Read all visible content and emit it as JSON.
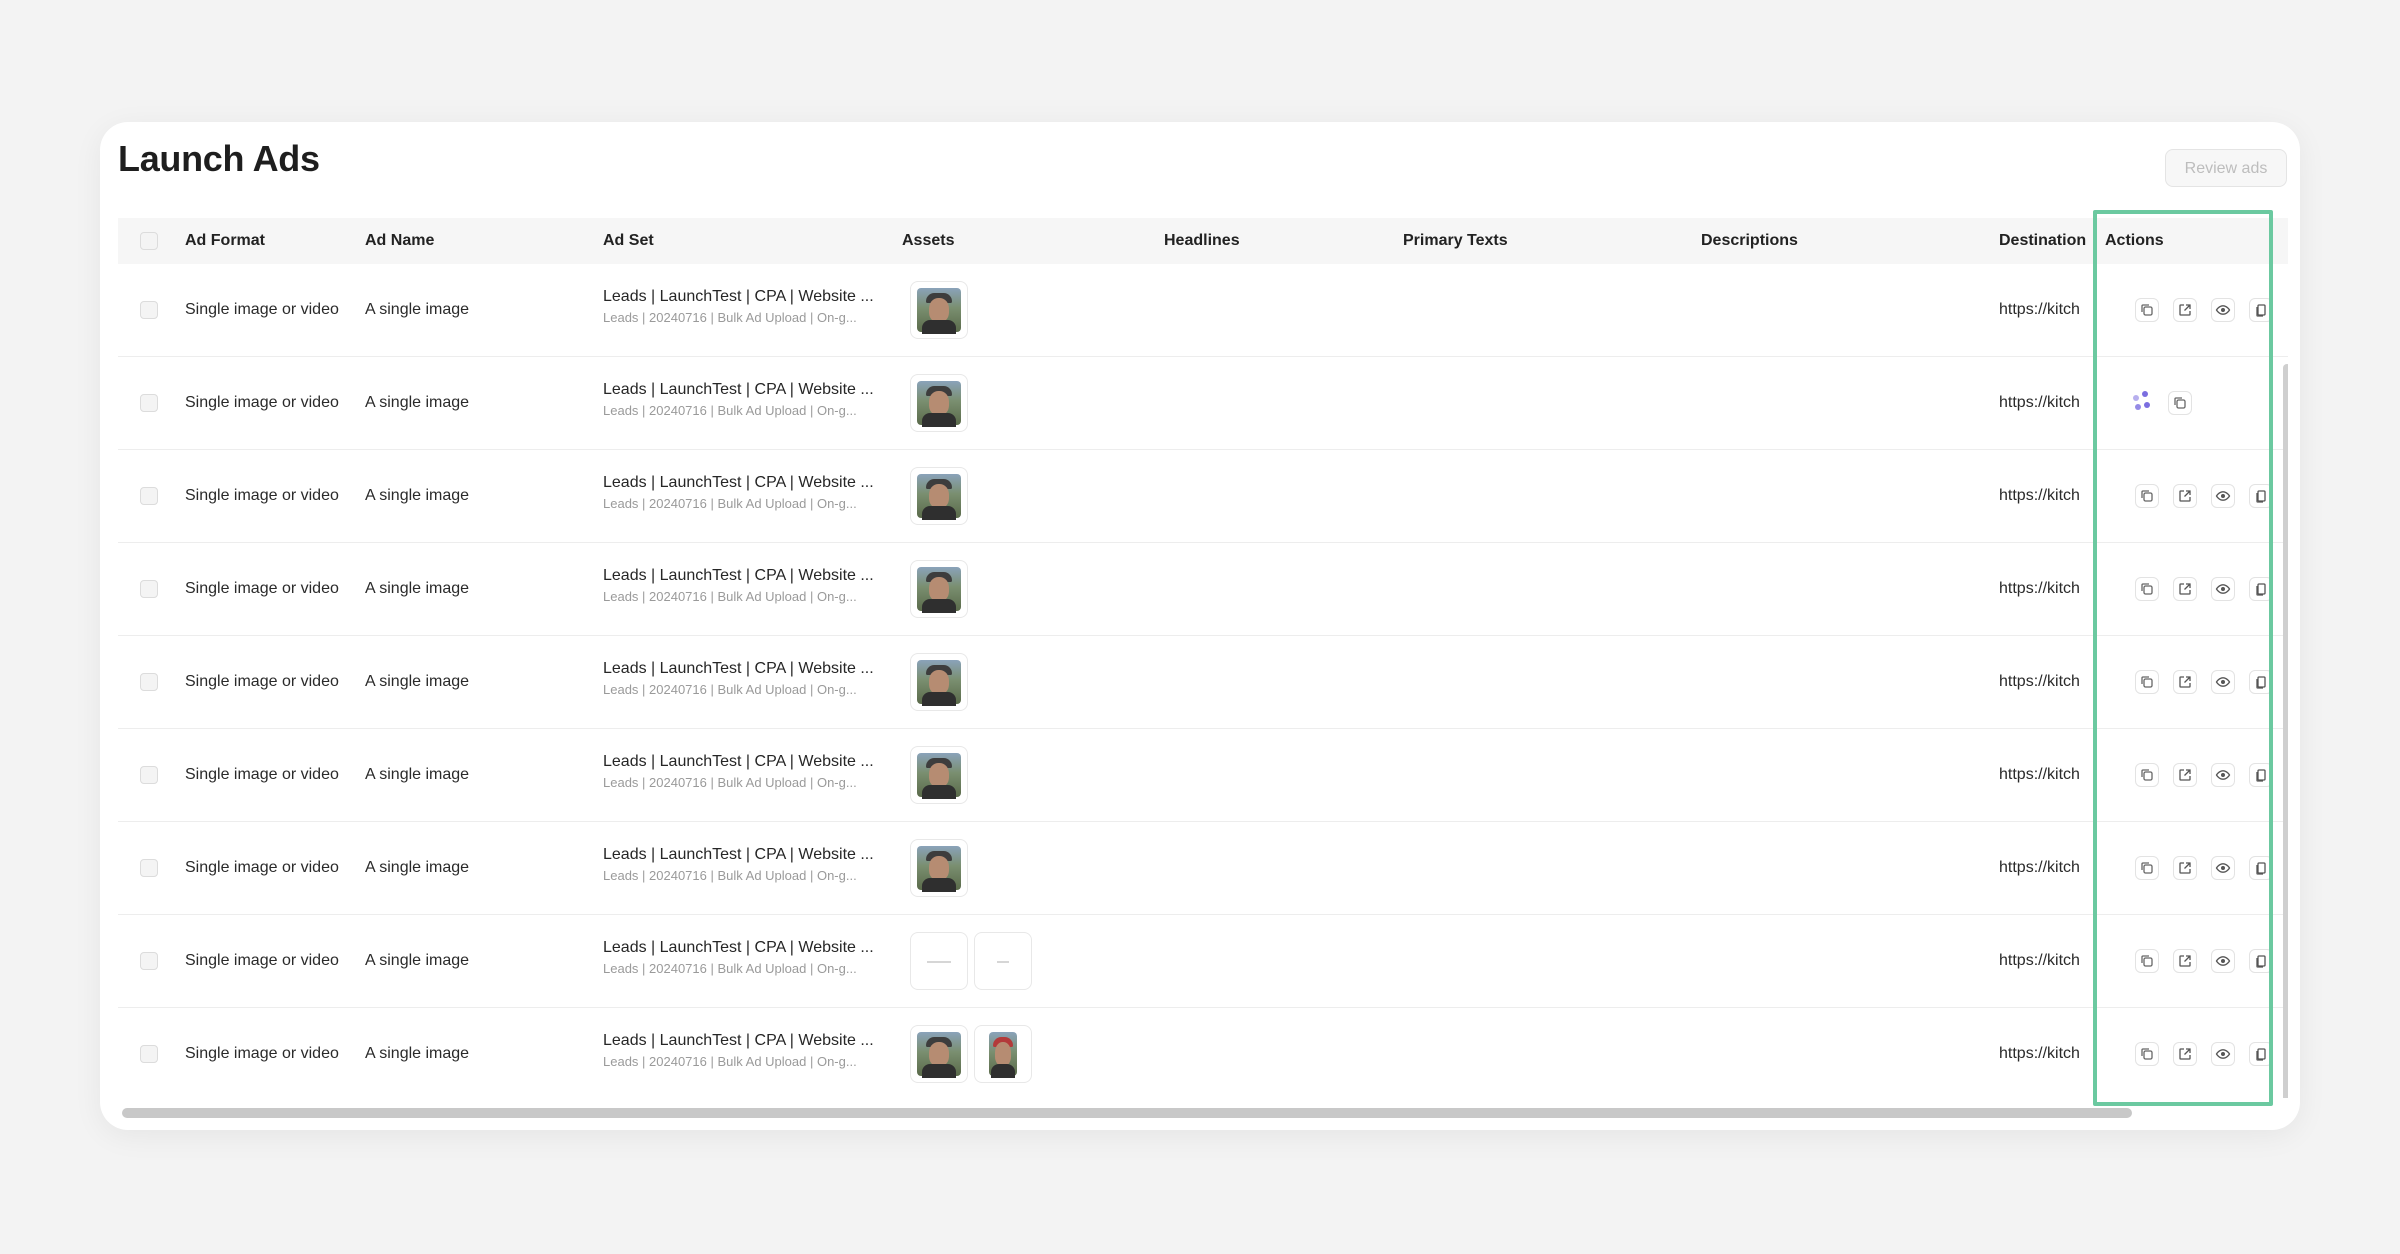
{
  "page": {
    "title": "Launch Ads",
    "review_label": "Review ads"
  },
  "colors": {
    "background": "#f3f3f3",
    "card": "#ffffff",
    "highlight": "#6bc9a0",
    "loader": "#7b6ee0"
  },
  "table": {
    "headers": [
      "Ad Format",
      "Ad Name",
      "Ad Set",
      "Assets",
      "Headlines",
      "Primary Texts",
      "Descriptions",
      "Destination",
      "Actions"
    ],
    "rows": [
      {
        "format": "Single image or video",
        "name": "A single image",
        "adset_main": "Leads | LaunchTest | CPA | Website ...",
        "adset_sub": "Leads | 20240716 | Bulk Ad Upload | On-g...",
        "assets": [
          "photo"
        ],
        "destination": "https://kitch",
        "state": "ready"
      },
      {
        "format": "Single image or video",
        "name": "A single image",
        "adset_main": "Leads | LaunchTest | CPA | Website ...",
        "adset_sub": "Leads | 20240716 | Bulk Ad Upload | On-g...",
        "assets": [
          "photo"
        ],
        "destination": "https://kitch",
        "state": "loading"
      },
      {
        "format": "Single image or video",
        "name": "A single image",
        "adset_main": "Leads | LaunchTest | CPA | Website ...",
        "adset_sub": "Leads | 20240716 | Bulk Ad Upload | On-g...",
        "assets": [
          "photo"
        ],
        "destination": "https://kitch",
        "state": "ready"
      },
      {
        "format": "Single image or video",
        "name": "A single image",
        "adset_main": "Leads | LaunchTest | CPA | Website ...",
        "adset_sub": "Leads | 20240716 | Bulk Ad Upload | On-g...",
        "assets": [
          "photo"
        ],
        "destination": "https://kitch",
        "state": "ready"
      },
      {
        "format": "Single image or video",
        "name": "A single image",
        "adset_main": "Leads | LaunchTest | CPA | Website ...",
        "adset_sub": "Leads | 20240716 | Bulk Ad Upload | On-g...",
        "assets": [
          "photo"
        ],
        "destination": "https://kitch",
        "state": "ready"
      },
      {
        "format": "Single image or video",
        "name": "A single image",
        "adset_main": "Leads | LaunchTest | CPA | Website ...",
        "adset_sub": "Leads | 20240716 | Bulk Ad Upload | On-g...",
        "assets": [
          "photo"
        ],
        "destination": "https://kitch",
        "state": "ready"
      },
      {
        "format": "Single image or video",
        "name": "A single image",
        "adset_main": "Leads | LaunchTest | CPA | Website ...",
        "adset_sub": "Leads | 20240716 | Bulk Ad Upload | On-g...",
        "assets": [
          "photo"
        ],
        "destination": "https://kitch",
        "state": "ready"
      },
      {
        "format": "Single image or video",
        "name": "A single image",
        "adset_main": "Leads | LaunchTest | CPA | Website ...",
        "adset_sub": "Leads | 20240716 | Bulk Ad Upload | On-g...",
        "assets": [
          "blank",
          "blank"
        ],
        "destination": "https://kitch",
        "state": "ready"
      },
      {
        "format": "Single image or video",
        "name": "A single image",
        "adset_main": "Leads | LaunchTest | CPA | Website ...",
        "adset_sub": "Leads | 20240716 | Bulk Ad Upload | On-g...",
        "assets": [
          "photo",
          "tall"
        ],
        "destination": "https://kitch",
        "state": "ready"
      }
    ]
  },
  "icons": {
    "ready": [
      "duplicate-icon",
      "external-link-icon",
      "eye-icon",
      "copy-icon"
    ],
    "loading": [
      "loading-spinner-icon",
      "duplicate-icon"
    ]
  }
}
